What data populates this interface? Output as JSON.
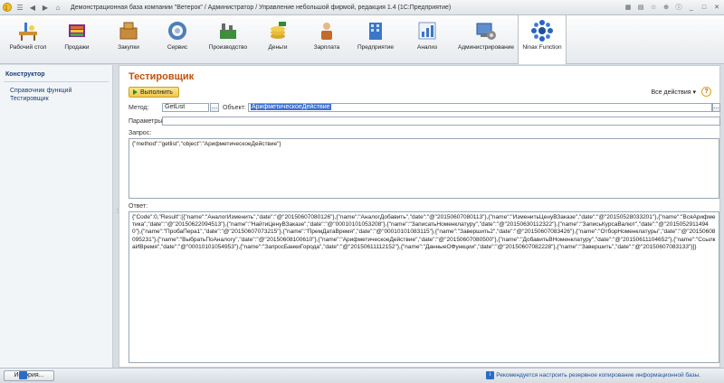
{
  "window": {
    "title": "Демонстрационная база компании \"Ветерок\" / Администратор / Управление небольшой фирмой, редакция 1.4  (1С:Предприятие)"
  },
  "toolbar": {
    "items": [
      {
        "label": "Рабочий стол",
        "icon": "desk-icon"
      },
      {
        "label": "Продажи",
        "icon": "sales-icon"
      },
      {
        "label": "Закупки",
        "icon": "purchases-icon"
      },
      {
        "label": "Сервис",
        "icon": "service-icon"
      },
      {
        "label": "Производство",
        "icon": "production-icon"
      },
      {
        "label": "Деньги",
        "icon": "money-icon"
      },
      {
        "label": "Зарплата",
        "icon": "salary-icon"
      },
      {
        "label": "Предприятие",
        "icon": "enterprise-icon"
      },
      {
        "label": "Анализ",
        "icon": "analysis-icon"
      },
      {
        "label": "Администрирование",
        "icon": "administration-icon"
      },
      {
        "label": "Ninax Function",
        "icon": "ninax-icon"
      }
    ]
  },
  "sidebar": {
    "heading": "Конструктор",
    "items": [
      "Справочник функций",
      "Тестировщик"
    ]
  },
  "form": {
    "title": "Тестировщик",
    "run_button": "Выполнить",
    "all_actions": "Все действия",
    "help": "?",
    "method_label": "Метод:",
    "method_value": "GetList",
    "object_label": "Объект:",
    "object_value": "АрифметическоеДействие",
    "params_label": "Параметры:",
    "params_value": "",
    "request_label": "Запрос:",
    "request_value": "{\"method\":\"getlist\",\"object\":\"АрифметическоеДействие\"}",
    "response_label": "Ответ:",
    "response_value": "{\"Code\":0,\"Result\":[{\"name\":\"АналогИзменить\",\"date\":\"@\"20150607080126\"},{\"name\":\"АналогДобавить\",\"date\":\"@\"20150607080113\"},{\"name\":\"ИзменитьЦенуВЗаказе\",\"date\":\"@\"20150528033201\"},{\"name\":\"ВсяАрифметика\",\"date\":\"@\"20150622094513\"},{\"name\":\"НайтиЦенуВЗаказе\",\"date\":\"@\"00010101053208\"},{\"name\":\"ЗаписатьНоменклатуру\",\"date\":\"@\"20150630112322\"},{\"name\":\"ЗаписьКурсаВалют\",\"date\":\"@\"20150529114940\"},{\"name\":\"ПробаПера1\",\"date\":\"@\"20150607073215\"},{\"name\":\"ПремДатаВремя\",\"date\":\"@\"00010101083115\"},{\"name\":\"Завершить2\",\"date\":\"@\"20150607083426\"},{\"name\":\"ОтборНоменклатуры\",\"date\":\"@\"20150608095231\"},{\"name\":\"ВыбратьПоАналогу\",\"date\":\"@\"20150608100610\"},{\"name\":\"АрифметическоеДействие\",\"date\":\"@\"20150607080500\"},{\"name\":\"ДобавитьВНоменклатуру\",\"date\":\"@\"20150611104652\"},{\"name\":\"СсылкаИВремя\",\"date\":\"@\"00010101054953\"},{\"name\":\"ЗапросБанкиГорода\",\"date\":\"@\"20150611112152\"},{\"name\":\"ДанныеОФункции\",\"date\":\"@\"20150607082228\"},{\"name\":\"Завершить\",\"date\":\"@\"20150607083133\"}]}"
  },
  "statusbar": {
    "history_button": "История...",
    "message": "Рекомендуется настроить резервное копирование информационной базы."
  }
}
